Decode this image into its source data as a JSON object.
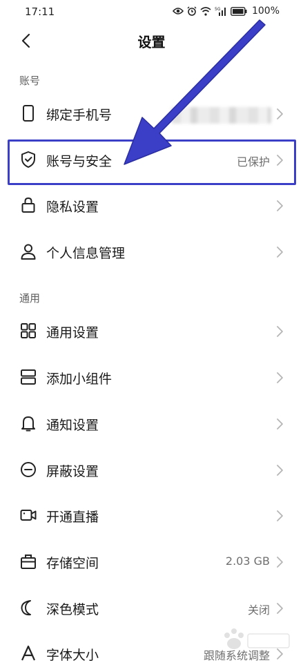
{
  "status_bar": {
    "time": "17:11",
    "battery": "100%",
    "network": "5G"
  },
  "header": {
    "title": "设置"
  },
  "sections": {
    "account": {
      "title": "账号",
      "items": [
        {
          "label": "绑定手机号",
          "value": "",
          "icon": "phone-icon"
        },
        {
          "label": "账号与安全",
          "value": "已保护",
          "icon": "shield-icon"
        },
        {
          "label": "隐私设置",
          "value": "",
          "icon": "lock-icon"
        },
        {
          "label": "个人信息管理",
          "value": "",
          "icon": "person-icon"
        }
      ]
    },
    "general": {
      "title": "通用",
      "items": [
        {
          "label": "通用设置",
          "value": "",
          "icon": "grid-icon"
        },
        {
          "label": "添加小组件",
          "value": "",
          "icon": "widget-icon"
        },
        {
          "label": "通知设置",
          "value": "",
          "icon": "bell-icon"
        },
        {
          "label": "屏蔽设置",
          "value": "",
          "icon": "block-icon"
        },
        {
          "label": "开通直播",
          "value": "",
          "icon": "video-icon"
        },
        {
          "label": "存储空间",
          "value": "2.03 GB",
          "icon": "storage-icon"
        },
        {
          "label": "深色模式",
          "value": "关闭",
          "icon": "moon-icon"
        },
        {
          "label": "字体大小",
          "value": "跟随系统调整",
          "icon": "font-icon"
        }
      ]
    }
  },
  "colors": {
    "annotation": "#3b3fc8",
    "text": "#1a1a1a",
    "secondary": "#6f6f6f"
  }
}
